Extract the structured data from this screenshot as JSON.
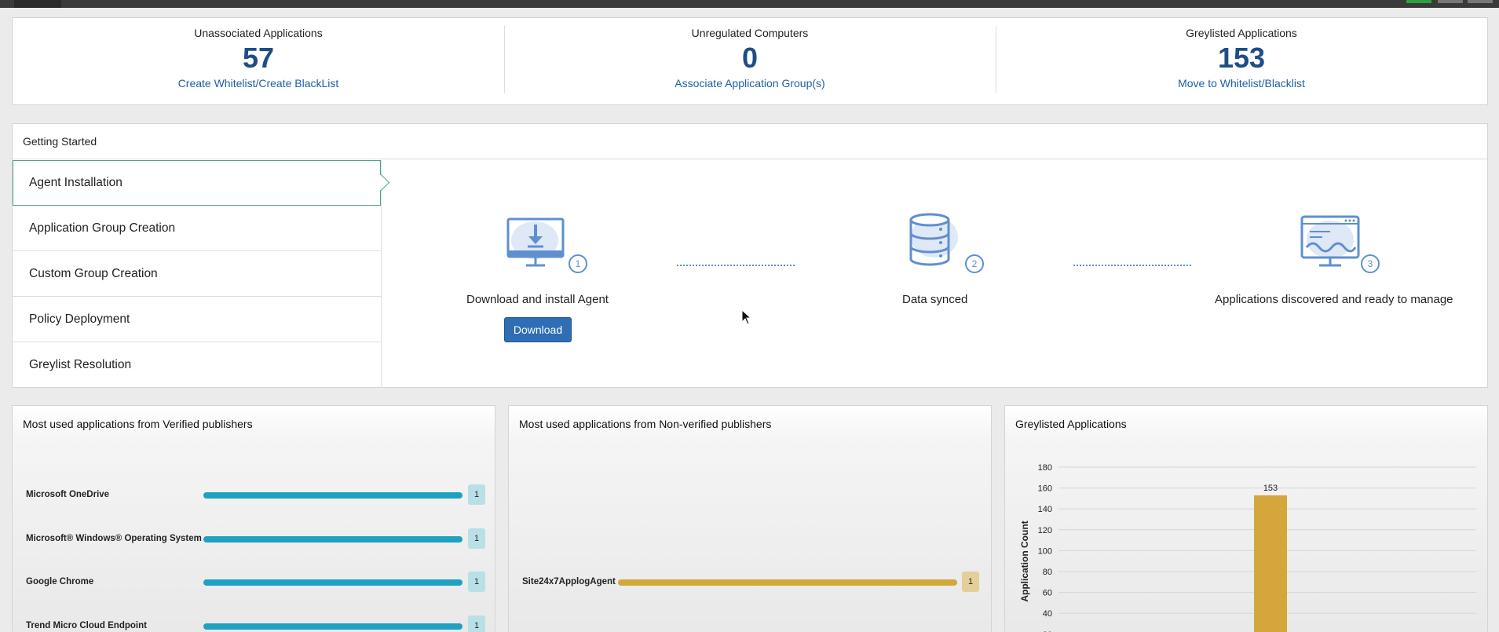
{
  "stats": [
    {
      "label": "Unassociated Applications",
      "value": "57",
      "link": "Create Whitelist/Create BlackList"
    },
    {
      "label": "Unregulated Computers",
      "value": "0",
      "link": "Associate Application Group(s)"
    },
    {
      "label": "Greylisted Applications",
      "value": "153",
      "link": "Move to Whitelist/Blacklist"
    }
  ],
  "getting_started": {
    "title": "Getting Started",
    "menu": [
      "Agent Installation",
      "Application Group Creation",
      "Custom Group Creation",
      "Policy Deployment",
      "Greylist Resolution"
    ],
    "steps": [
      {
        "num": "1",
        "caption": "Download and install Agent"
      },
      {
        "num": "2",
        "caption": "Data synced"
      },
      {
        "num": "3",
        "caption": "Applications discovered and ready to manage"
      }
    ],
    "download_label": "Download"
  },
  "panels": {
    "verified": {
      "title": "Most used applications from Verified publishers",
      "items": [
        {
          "name": "Microsoft OneDrive",
          "value": "1"
        },
        {
          "name": "Microsoft® Windows® Operating System",
          "value": "1"
        },
        {
          "name": "Google Chrome",
          "value": "1"
        },
        {
          "name": "Trend Micro Cloud Endpoint",
          "value": "1"
        }
      ]
    },
    "nonverified": {
      "title": "Most used applications from Non-verified publishers",
      "items": [
        {
          "name": "Site24x7ApplogAgent",
          "value": "1"
        }
      ]
    },
    "greylisted": {
      "title": "Greylisted Applications"
    }
  },
  "colors": {
    "accent": "#1f4e84",
    "verified_bar": "#1fa1c2",
    "nonverified_bar": "#d1a83a",
    "grey_bar": "#d4a73d"
  },
  "chart_data": {
    "type": "bar",
    "title": "Greylisted Applications",
    "ylabel": "Application Count",
    "xlabel": "",
    "categories": [
      ""
    ],
    "values": [
      153
    ],
    "ylim": [
      0,
      180
    ],
    "yticks": [
      20,
      40,
      60,
      80,
      100,
      120,
      140,
      160,
      180
    ],
    "data_labels": [
      "153"
    ],
    "grid": true
  }
}
